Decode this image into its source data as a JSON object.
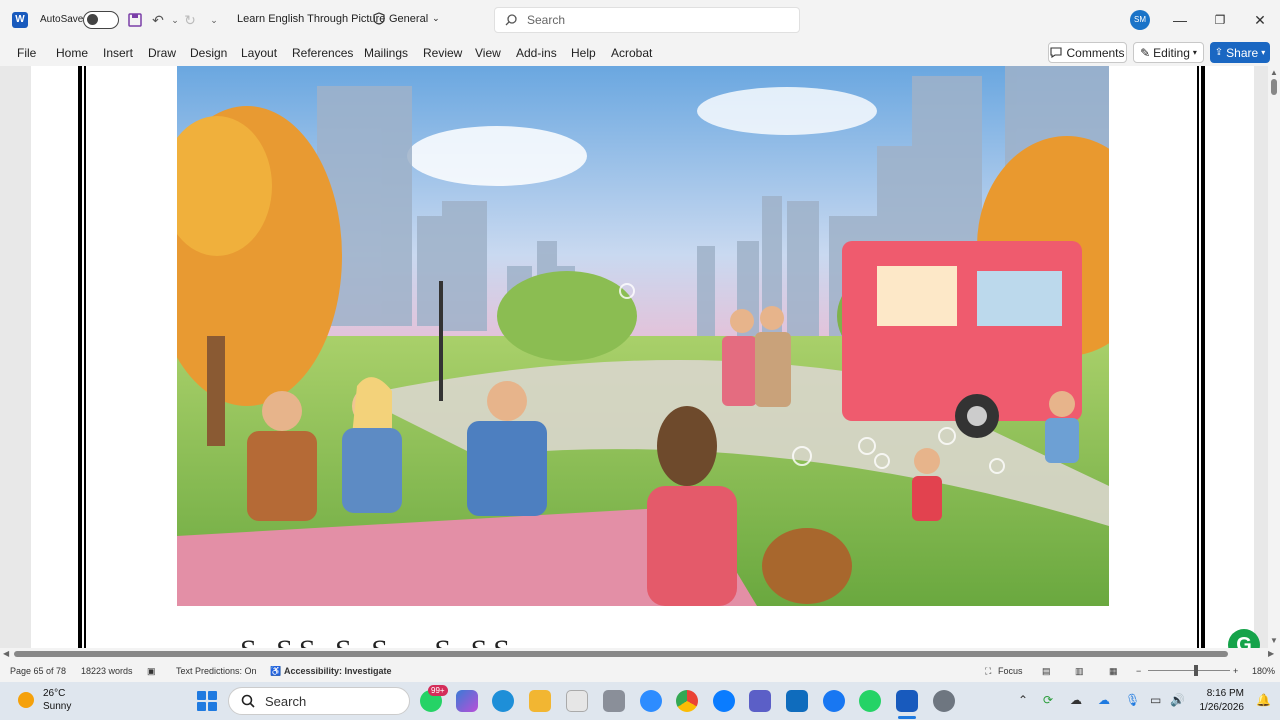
{
  "titlebar": {
    "autosave_label": "AutoSave",
    "doc_title": "Learn English Through Picture",
    "sensitivity_label": "General",
    "search_placeholder": "Search",
    "avatar_initials": "SM"
  },
  "ribbon": {
    "tabs": [
      "File",
      "Home",
      "Insert",
      "Draw",
      "Design",
      "Layout",
      "References",
      "Mailings",
      "Review",
      "View",
      "Add-ins",
      "Help",
      "Acrobat"
    ],
    "comments_label": "Comments",
    "editing_label": "Editing",
    "share_label": "Share"
  },
  "document": {
    "next_line_text": "S  SS         S  S  ,          S  SS"
  },
  "statusbar": {
    "page_info": "Page 65 of 78",
    "word_count": "18223 words",
    "text_predictions": "Text Predictions: On",
    "accessibility": "Accessibility: Investigate",
    "focus_label": "Focus",
    "zoom_level": "180%"
  },
  "taskbar": {
    "temperature": "26°C",
    "condition": "Sunny",
    "search_label": "Search",
    "badge_count": "99+",
    "time": "8:16 PM",
    "date": "1/26/2026"
  },
  "colors": {
    "word_blue": "#185abd",
    "share_blue": "#1a67c2",
    "grammarly_green": "#15a34a"
  }
}
